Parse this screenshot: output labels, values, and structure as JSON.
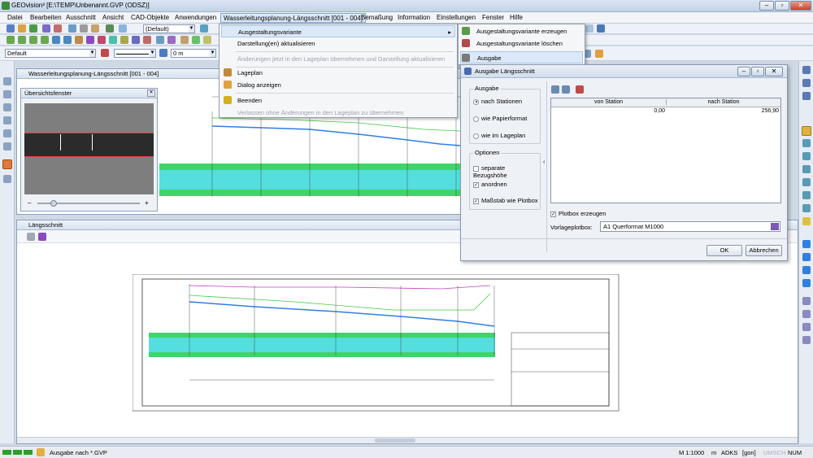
{
  "app": {
    "title": "GEOvision³ [E:\\TEMP\\Unbenannt.GVP (ODSZ)]"
  },
  "menu": [
    "Datei",
    "Bearbeiten",
    "Ausschnitt",
    "Ansicht",
    "CAD-Objekte",
    "Anwendungen",
    "Wasserleitungsplanung-Längsschnitt [001 - 004]",
    "Bemaßung",
    "Information",
    "Einstellungen",
    "Fenster",
    "Hilfe"
  ],
  "toolbar": {
    "layer_combo": "(Default)",
    "style_combo": "Default",
    "offset_combo": "0 m"
  },
  "dropdown": {
    "items": [
      {
        "label": "Ausgestaltungsvariante",
        "sub": true
      },
      {
        "label": "Darstellung(en) aktualisieren"
      },
      {
        "label": "Änderungen jetzt in den Lageplan übernehmen und Darstellung aktualisieren"
      },
      {
        "label": "Lageplan"
      },
      {
        "label": "Dialog anzeigen"
      },
      {
        "label": "Beenden"
      },
      {
        "label": "Verlassen ohne Änderungen in den Lageplan zu übernehmen"
      }
    ]
  },
  "submenu": {
    "items": [
      "Ausgestaltungsvariante erzeugen",
      "Ausgestaltungsvariante löschen",
      "Ausgabe"
    ]
  },
  "windows": {
    "profile": "Wasserleitungsplanung-Längsschnitt [001 - 004]",
    "overview": "Übersichtsfenster",
    "longsection": "Längsschnitt"
  },
  "dialog": {
    "title": "Ausgabe Längsschnitt",
    "group_output": "Ausgabe",
    "opt_station": "nach Stationen",
    "opt_paper": "wie Papierformat",
    "opt_site": "wie im Lageplan",
    "group_options": "Optionen",
    "chk_height": "separate Bezugshöhe",
    "chk_arrange": "anordnen",
    "chk_scale": "Maßstab wie Plotbox",
    "col_from": "von Station",
    "col_to": "nach Station",
    "row_from": "0,00",
    "row_to": "256,90",
    "chk_plotbox": "Plotbox erzeugen",
    "plotbox_label": "Vorlageplotbox:",
    "plotbox_value": "A1 Querformat M1000",
    "ok": "OK",
    "cancel": "Abbrechen"
  },
  "status": {
    "text": "Ausgabe nach *.GVP",
    "scale": "M 1:1000",
    "unit": "m",
    "adks": "ADKS",
    "angle": "[gon]",
    "umsch": "UMSCH",
    "num": "NUM"
  },
  "colors": {
    "highlight": "#dbe8f7",
    "band_green": "#3fd46a",
    "band_cyan": "#54dede",
    "line_blue": "#2f7fe0",
    "line_green": "#47c84a",
    "line_magenta": "#c23fc2"
  }
}
